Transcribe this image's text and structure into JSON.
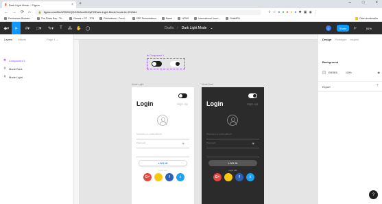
{
  "browser": {
    "tab_title": "Dark Light Mode – Figma",
    "tab_close": "×",
    "new_tab": "+",
    "window_controls": [
      "–",
      "□",
      "×"
    ],
    "url": "figma.com/file/xR5GKQGGZb5on0Ib9pFZ/Dark-Light-Mode?node-id=0%3A1",
    "bookmarks": [
      "Pembaruan Biodata...",
      "The Pirate Bay - Th...",
      "Games > PC - TPB",
      "Publications - Facul...",
      "SER Presentations",
      "Beset",
      "HCMS",
      "International Journ...",
      "ShalMRX"
    ],
    "other_bookmarks": "Other bookmarks"
  },
  "toolbar": {
    "tools": [
      "figma-menu",
      "move",
      "frame",
      "shape",
      "pen",
      "text",
      "resources",
      "hand",
      "comment"
    ],
    "drafts": "Drafts",
    "separator": "/",
    "file_name": "Dark Light Mode",
    "file_chevron": "⌄",
    "avatar_initial": "D",
    "share": "Share",
    "play": "▷",
    "zoom": "81%"
  },
  "left_panel": {
    "tabs": [
      "Layers",
      "Assets"
    ],
    "page": "Page 1",
    "layers": [
      {
        "icon": "component-icon",
        "glyph": "❖",
        "label": "Component 1"
      },
      {
        "icon": "frame-icon",
        "glyph": "#",
        "label": "Mode Dark"
      },
      {
        "icon": "frame-icon",
        "glyph": "#",
        "label": "Mode Light"
      }
    ]
  },
  "canvas": {
    "component_label": "❖ Component 1",
    "frame_light_label": "Mode Light",
    "frame_dark_label": "Mode Dark",
    "login_title": "Login",
    "sign_up": "Sign Up",
    "username_placeholder": "Username or email address",
    "password_placeholder": "Password",
    "eye": "◉",
    "login_button": "LOG IN",
    "or_text": "Login with",
    "social": [
      "G+",
      "",
      "f",
      "t"
    ]
  },
  "right_panel": {
    "tabs": [
      "Design",
      "Prototype",
      "Inspect"
    ],
    "background_title": "Background",
    "bg_hex": "E5E5E5",
    "bg_opacity": "100%",
    "export": "Export",
    "export_plus": "+"
  },
  "help": "?",
  "colors": {
    "figma_blue": "#0d99ff",
    "component_purple": "#9747ff",
    "canvas_bg": "#e5e5e5",
    "toolbar_bg": "#2c2c2c",
    "dark_frame": "#2b2b2b"
  }
}
